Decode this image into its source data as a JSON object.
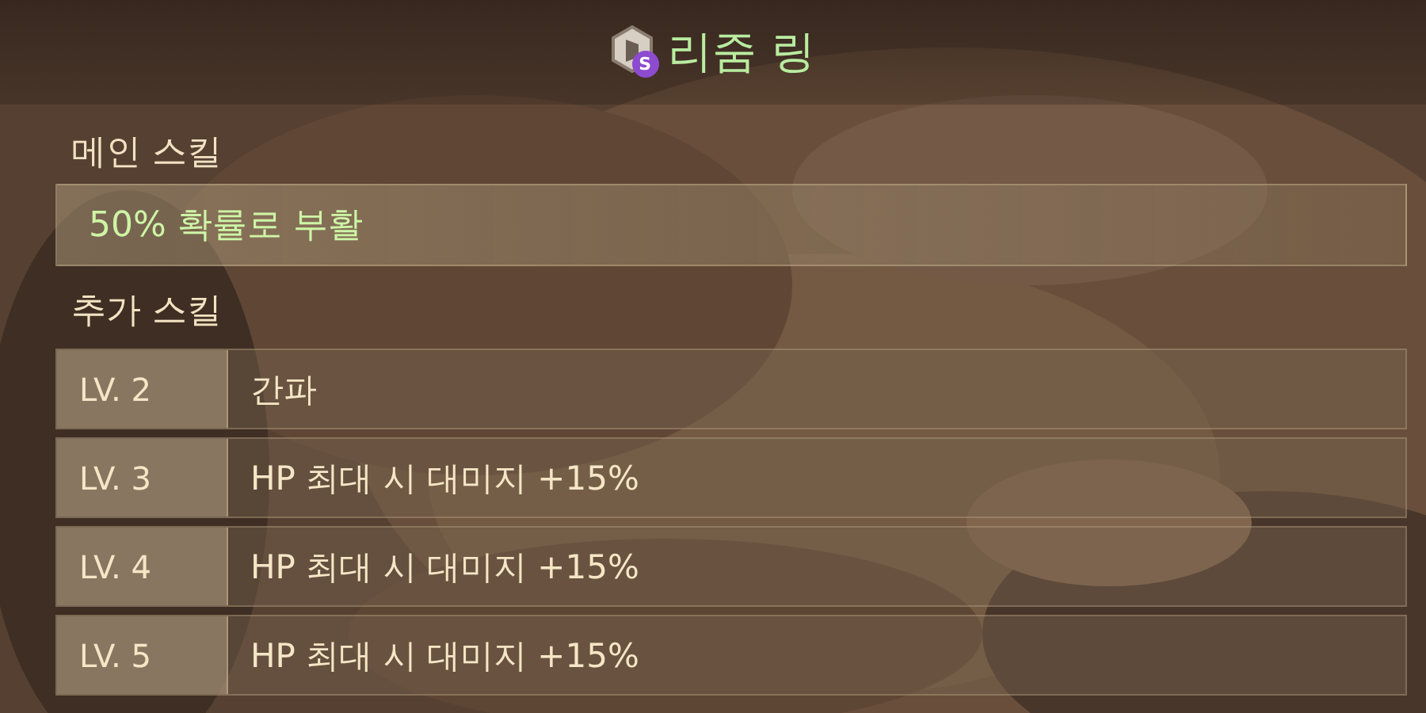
{
  "title": {
    "text": "리줌 링",
    "grade_badge": "S"
  },
  "main_skill": {
    "label": "메인 스킬",
    "value": "50% 확률로 부활"
  },
  "extra_skills": {
    "label": "추가 스킬",
    "rows": [
      {
        "level": "LV. 2",
        "effect": "간파"
      },
      {
        "level": "LV. 3",
        "effect": "HP 최대 시 대미지 +15%"
      },
      {
        "level": "LV. 4",
        "effect": "HP 최대 시 대미지 +15%"
      },
      {
        "level": "LV. 5",
        "effect": "HP 최대 시 대미지 +15%"
      }
    ]
  }
}
